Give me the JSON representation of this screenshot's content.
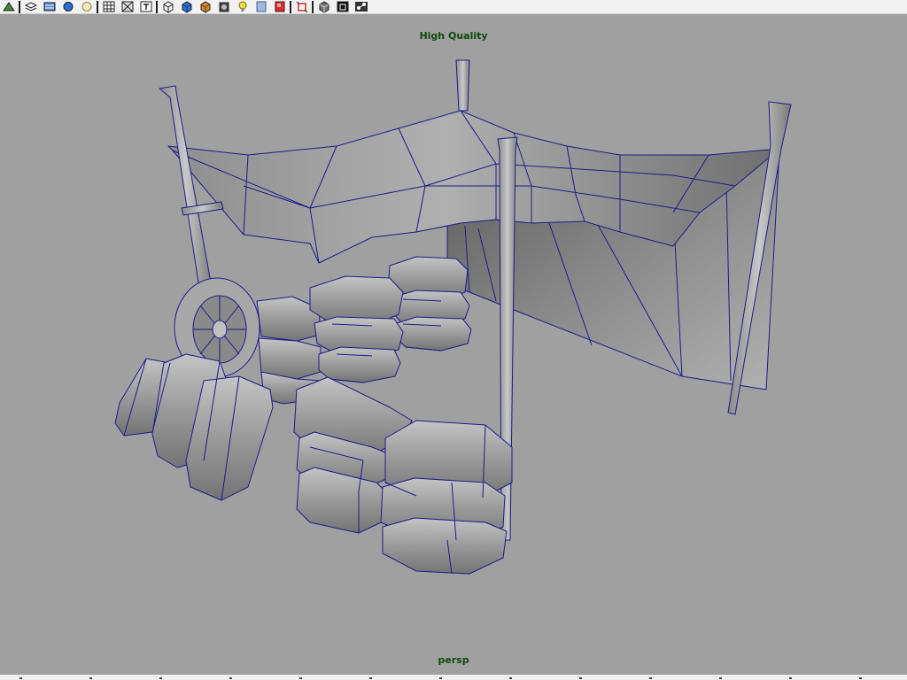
{
  "toolbar": {
    "buttons": [
      {
        "name": "render-view-icon",
        "group": 1
      },
      {
        "name": "sep"
      },
      {
        "name": "layers-icon",
        "group": 1
      },
      {
        "name": "render-settings-icon",
        "group": 1
      },
      {
        "name": "hypershade-icon",
        "group": 1
      },
      {
        "name": "light-icon",
        "group": 1
      },
      {
        "name": "sep"
      },
      {
        "name": "grid-icon",
        "group": 2
      },
      {
        "name": "texture-editor-icon",
        "group": 2
      },
      {
        "name": "text-icon",
        "group": 2
      },
      {
        "name": "sep"
      },
      {
        "name": "wireframe-cube-icon",
        "group": 3
      },
      {
        "name": "shaded-cube-icon",
        "group": 3
      },
      {
        "name": "textured-cube-icon",
        "group": 3
      },
      {
        "name": "smooth-shade-icon",
        "group": 3
      },
      {
        "name": "light-bulb-icon",
        "group": 3
      },
      {
        "name": "shadow-icon",
        "group": 3
      },
      {
        "name": "material-icon",
        "group": 3
      },
      {
        "name": "sep"
      },
      {
        "name": "isolate-select-icon",
        "group": 4
      },
      {
        "name": "sep"
      },
      {
        "name": "xray-icon",
        "group": 4
      },
      {
        "name": "backface-icon",
        "group": 4
      },
      {
        "name": "node-editor-icon",
        "group": 4
      }
    ],
    "colors": {
      "background": "#f2f2f2",
      "icon_dark": "#222222",
      "icon_blue": "#2a6fd6",
      "icon_orange": "#d48a2a",
      "icon_red": "#d43030",
      "icon_yellow": "#f0e040"
    }
  },
  "viewport": {
    "quality_label": "High Quality",
    "camera_label": "persp",
    "label_color": "#0f4a0f",
    "background": "#a0a0a0",
    "wire_color": "#1c1c8a",
    "scene": "market-stall-wireframe"
  }
}
